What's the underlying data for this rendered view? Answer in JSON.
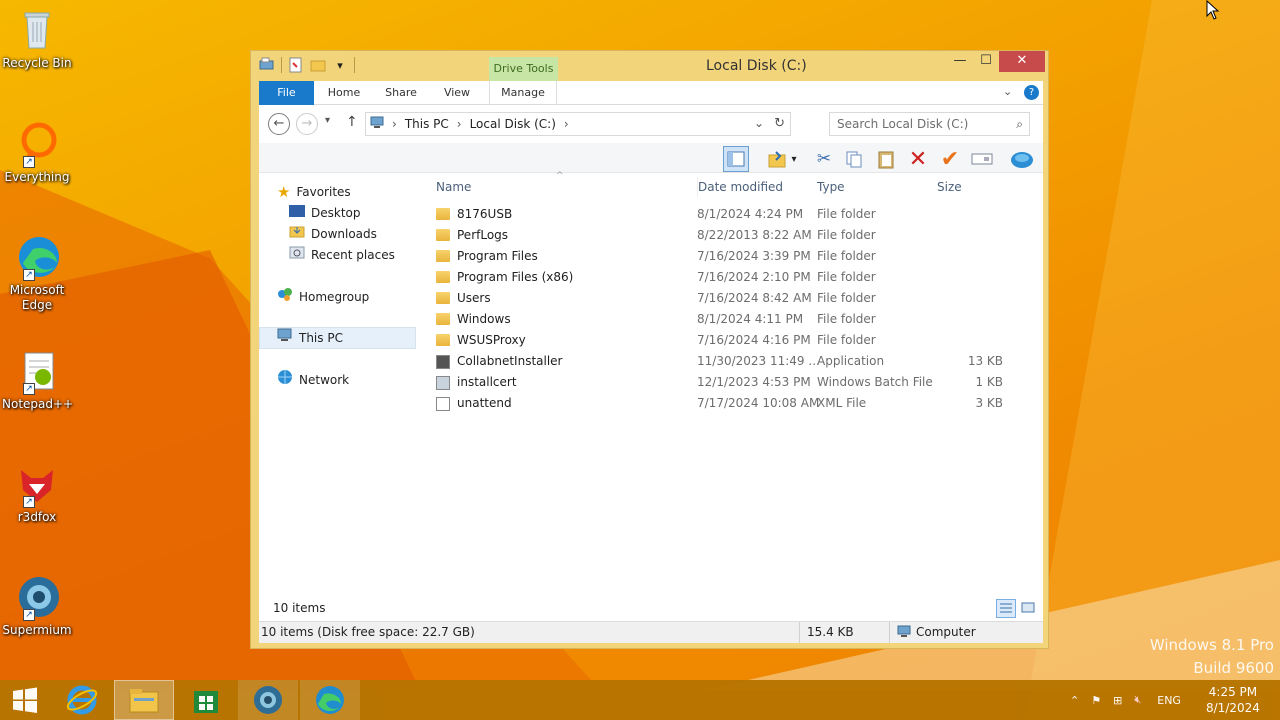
{
  "desktop": {
    "icons": [
      {
        "label": "Recycle Bin"
      },
      {
        "label": "Everything"
      },
      {
        "label": "Microsoft Edge"
      },
      {
        "label": "Notepad++"
      },
      {
        "label": "r3dfox"
      },
      {
        "label": "Supermium"
      }
    ],
    "watermark_line1": "Windows 8.1 Pro",
    "watermark_line2": "Build 9600"
  },
  "window": {
    "title": "Local Disk (C:)",
    "contextual_tab": "Drive Tools",
    "ribbon_tabs": [
      "File",
      "Home",
      "Share",
      "View",
      "Manage"
    ],
    "address": {
      "segments": [
        "This PC",
        "Local Disk (C:)"
      ]
    },
    "search_placeholder": "Search Local Disk (C:)",
    "nav": {
      "favorites": "Favorites",
      "favorites_items": [
        "Desktop",
        "Downloads",
        "Recent places"
      ],
      "homegroup": "Homegroup",
      "this_pc": "This PC",
      "network": "Network"
    },
    "columns": {
      "name": "Name",
      "date": "Date modified",
      "type": "Type",
      "size": "Size"
    },
    "files": [
      {
        "name": "8176USB",
        "date": "8/1/2024 4:24 PM",
        "type": "File folder",
        "size": "",
        "icon": "folder-icon"
      },
      {
        "name": "PerfLogs",
        "date": "8/22/2013 8:22 AM",
        "type": "File folder",
        "size": "",
        "icon": "folder-icon"
      },
      {
        "name": "Program Files",
        "date": "7/16/2024 3:39 PM",
        "type": "File folder",
        "size": "",
        "icon": "folder-icon"
      },
      {
        "name": "Program Files (x86)",
        "date": "7/16/2024 2:10 PM",
        "type": "File folder",
        "size": "",
        "icon": "folder-icon"
      },
      {
        "name": "Users",
        "date": "7/16/2024 8:42 AM",
        "type": "File folder",
        "size": "",
        "icon": "folder-icon"
      },
      {
        "name": "Windows",
        "date": "8/1/2024 4:11 PM",
        "type": "File folder",
        "size": "",
        "icon": "folder-icon"
      },
      {
        "name": "WSUSProxy",
        "date": "7/16/2024 4:16 PM",
        "type": "File folder",
        "size": "",
        "icon": "folder-icon"
      },
      {
        "name": "CollabnetInstaller",
        "date": "11/30/2023 11:49 ...",
        "type": "Application",
        "size": "13 KB",
        "icon": "application-icon"
      },
      {
        "name": "installcert",
        "date": "12/1/2023 4:53 PM",
        "type": "Windows Batch File",
        "size": "1 KB",
        "icon": "batch-file-icon"
      },
      {
        "name": "unattend",
        "date": "7/17/2024 10:08 AM",
        "type": "XML File",
        "size": "3 KB",
        "icon": "xml-file-icon"
      }
    ],
    "item_count": "10 items",
    "status": {
      "left": "10 items (Disk free space: 22.7 GB)",
      "size": "15.4 KB",
      "location": "Computer"
    }
  },
  "taskbar": {
    "language": "ENG",
    "time": "4:25 PM",
    "date": "8/1/2024"
  },
  "colors": {
    "accent": "#1979ca",
    "close": "#c74b4b",
    "taskbar": "#b77400",
    "window_frame": "#f2d47a"
  }
}
